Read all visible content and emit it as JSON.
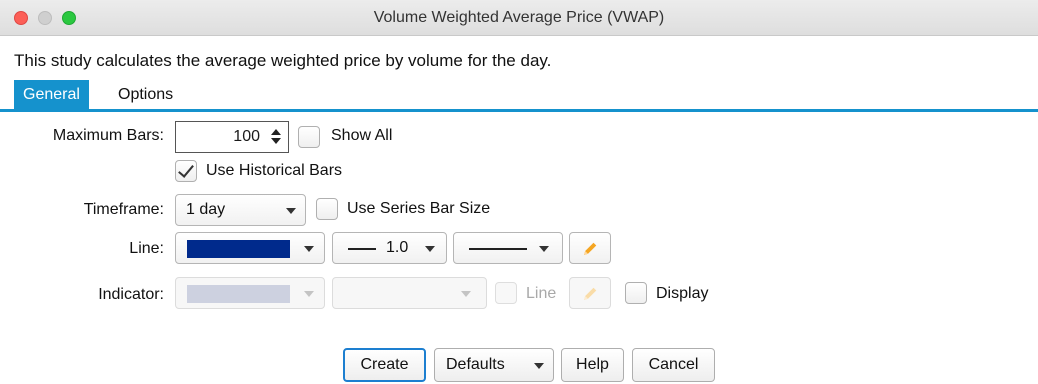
{
  "window": {
    "title": "Volume Weighted Average Price (VWAP)"
  },
  "description": "This study calculates the average weighted price by volume for the day.",
  "tabs": [
    {
      "label": "General",
      "active": true
    },
    {
      "label": "Options",
      "active": false
    }
  ],
  "form": {
    "maximum_bars": {
      "label": "Maximum Bars:",
      "value": "100",
      "show_all_label": "Show All",
      "show_all_checked": false
    },
    "use_historical": {
      "label": "Use Historical Bars",
      "checked": true
    },
    "timeframe": {
      "label": "Timeframe:",
      "value": "1 day",
      "series_bar_label": "Use Series Bar Size",
      "series_bar_checked": false
    },
    "line": {
      "label": "Line:",
      "color": "#002a8c",
      "width_value": "1.0"
    },
    "indicator": {
      "label": "Indicator:",
      "color": "#cdd1e0",
      "line_label": "Line",
      "display_label": "Display",
      "display_checked": false
    }
  },
  "buttons": {
    "create": "Create",
    "defaults": "Defaults",
    "help": "Help",
    "cancel": "Cancel"
  },
  "colors": {
    "accent": "#1592cd",
    "line_swatch": "#002a8c",
    "pencil": "#f5a623"
  }
}
